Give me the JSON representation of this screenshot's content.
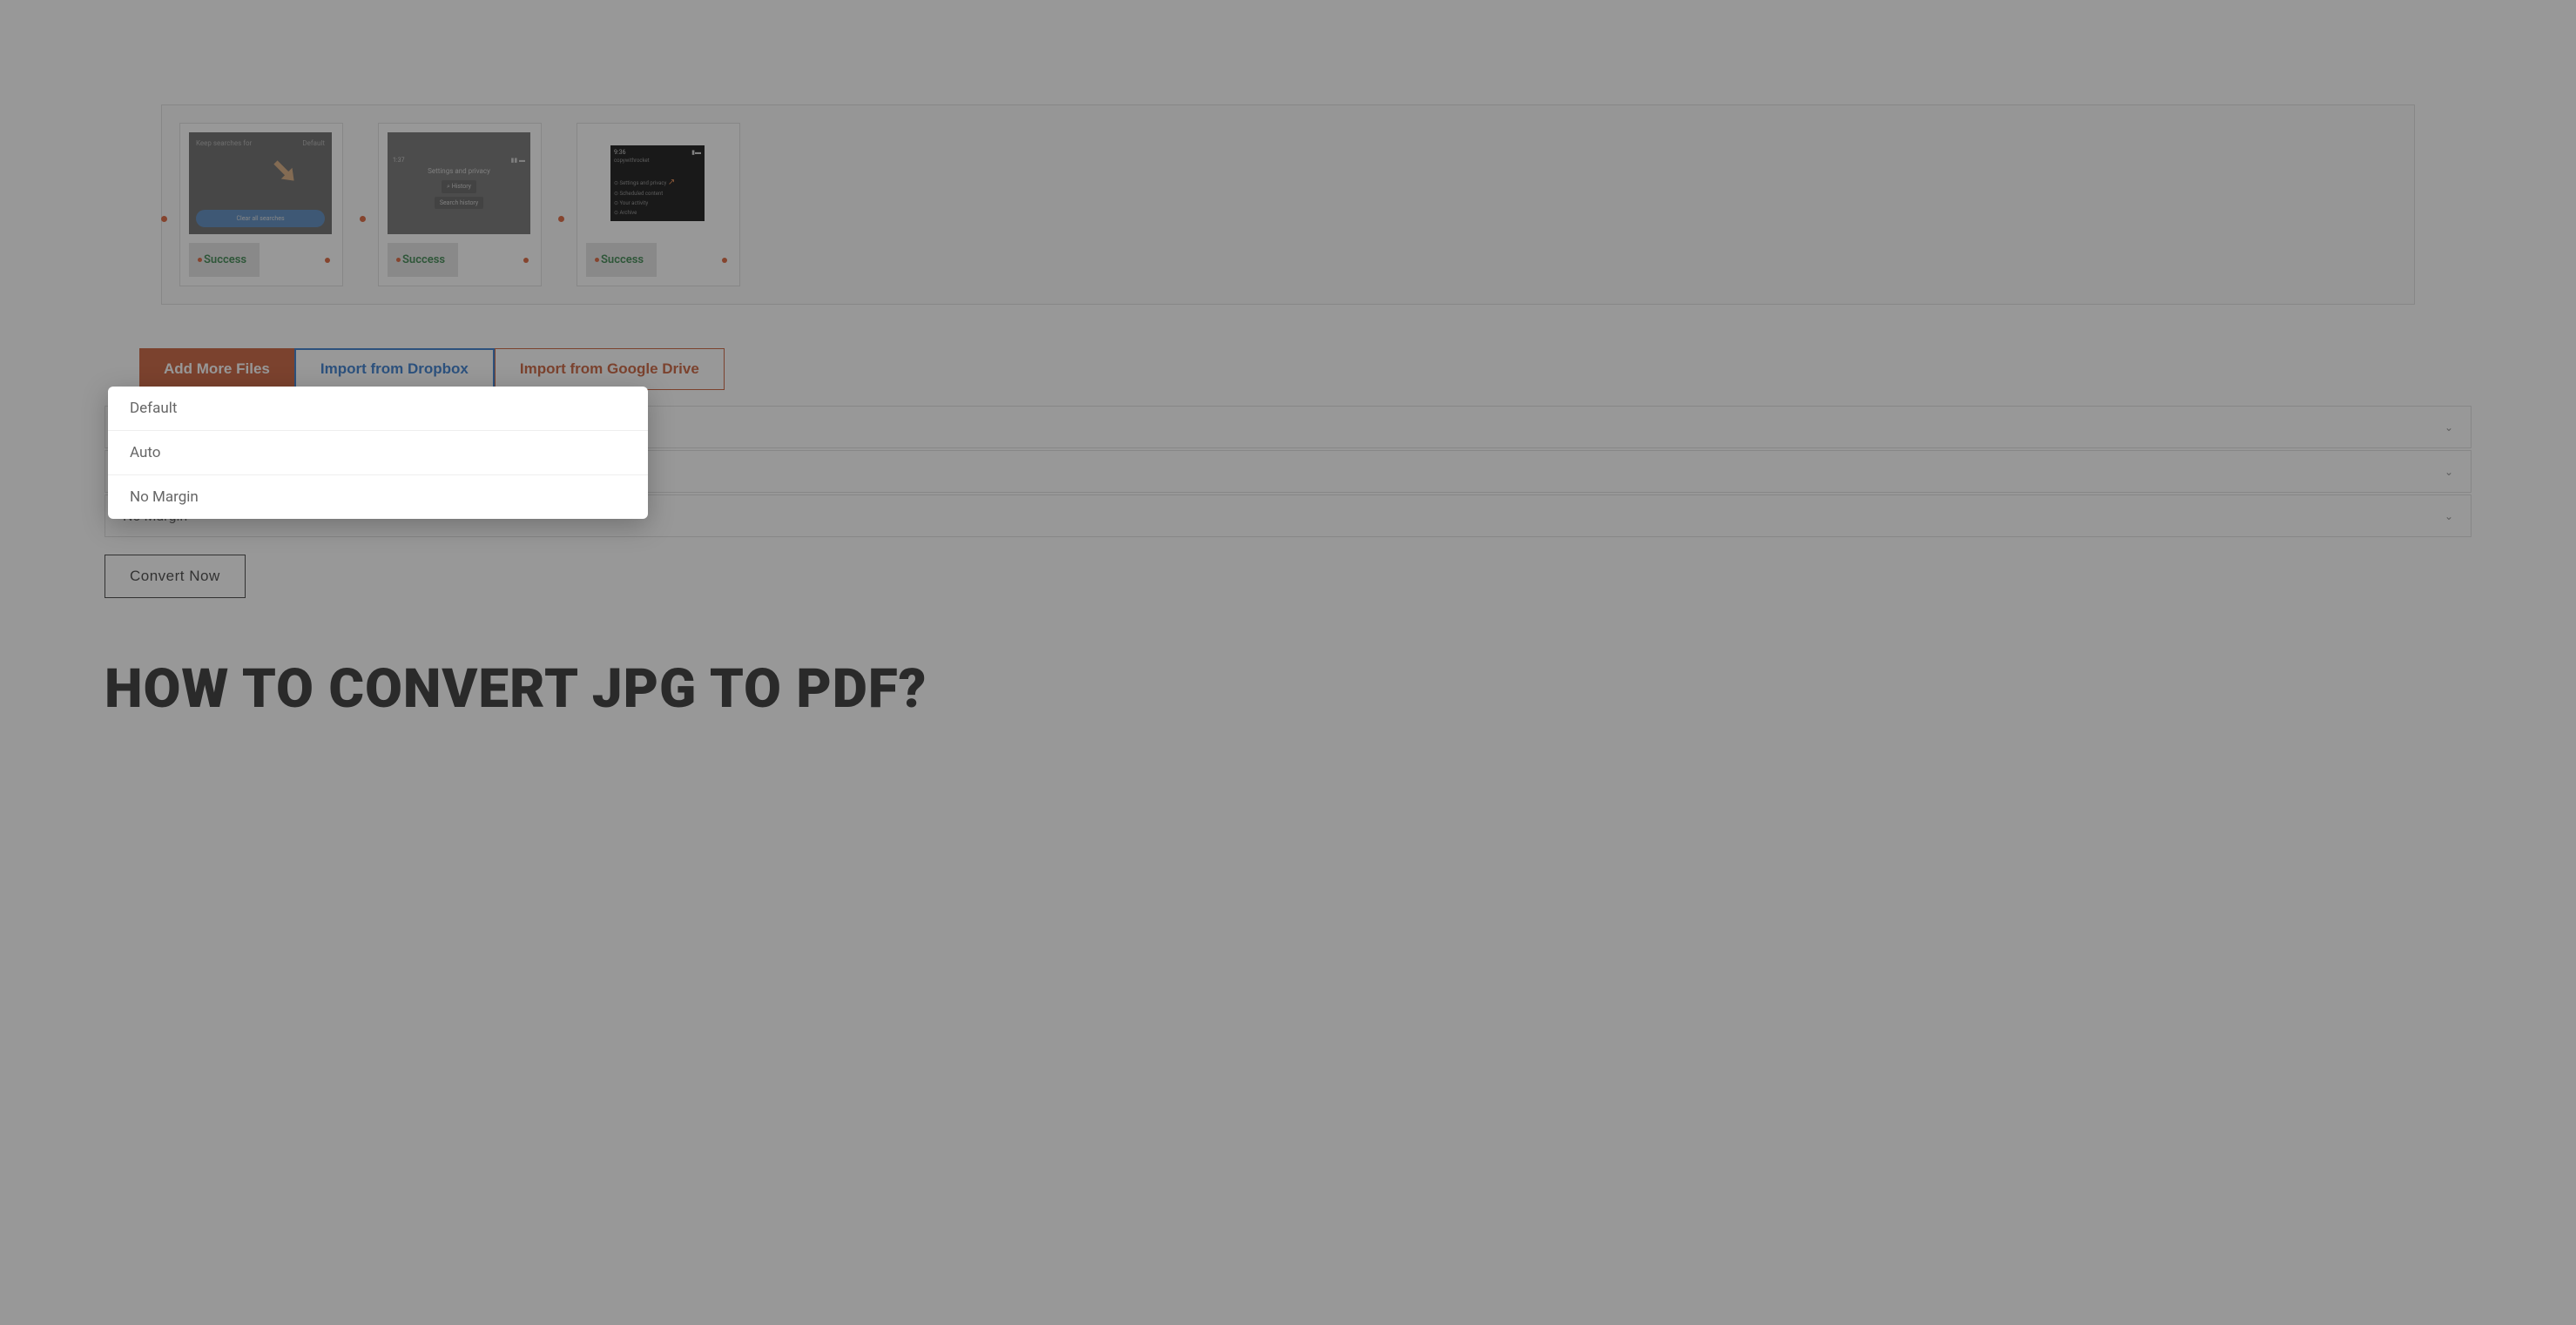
{
  "filePreview": {
    "cards": [
      {
        "status": "Success",
        "thumbText": "Keep searches for",
        "thumbBtn": "Clear all searches",
        "thumbDefault": "Default"
      },
      {
        "status": "Success",
        "thumbTime": "1:37",
        "thumbTitle": "Settings and privacy",
        "thumbHistory": "History",
        "thumbSearch": "Search history"
      },
      {
        "status": "Success",
        "thumbTime": "9:36",
        "thumbUser": "copywithrocket",
        "thumbRows": [
          "Settings and privacy",
          "Scheduled content",
          "Your activity",
          "Archive"
        ]
      }
    ]
  },
  "buttons": {
    "addMore": "Add More Files",
    "dropbox": "Import from Dropbox",
    "gdrive": "Import from Google Drive"
  },
  "selects": {
    "row1": "Default",
    "row2": "Auto",
    "row3": "No Margin"
  },
  "convertBtn": "Convert Now",
  "heading": "HOW TO CONVERT JPG TO PDF?",
  "dropdown": {
    "options": [
      "Default",
      "Auto",
      "No Margin"
    ]
  }
}
